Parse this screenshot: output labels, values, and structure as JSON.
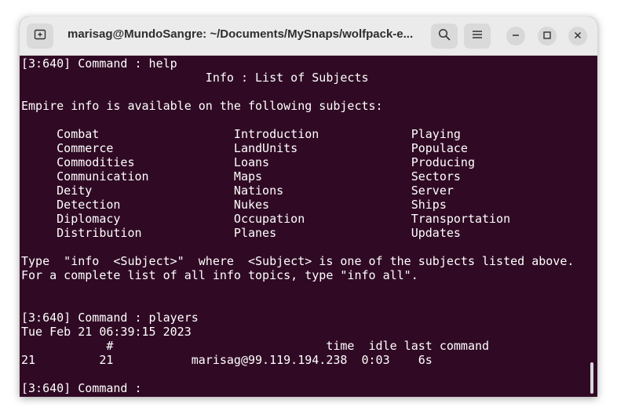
{
  "window": {
    "title": "marisag@MundoSangre: ~/Documents/MySnaps/wolfpack-e..."
  },
  "icons": {
    "new_tab": "new-tab-icon",
    "search": "search-icon",
    "menu": "hamburger-menu-icon",
    "minimize": "minimize-icon",
    "maximize": "maximize-icon",
    "close": "close-icon"
  },
  "colors": {
    "terminal_background": "#300a24",
    "terminal_text": "#ffffff",
    "titlebar": "#ebebeb"
  },
  "terminal": {
    "lines": [
      "[3:640] Command : help",
      "                          Info : List of Subjects",
      "",
      "Empire info is available on the following subjects:",
      "",
      "     Combat                   Introduction             Playing",
      "     Commerce                 LandUnits                Populace",
      "     Commodities              Loans                    Producing",
      "     Communication            Maps                     Sectors",
      "     Deity                    Nations                  Server",
      "     Detection                Nukes                    Ships",
      "     Diplomacy                Occupation               Transportation",
      "     Distribution             Planes                   Updates",
      "",
      "Type  \"info  <Subject>\"  where  <Subject> is one of the subjects listed above.",
      "For a complete list of all info topics, type \"info all\".",
      "",
      "",
      "[3:640] Command : players",
      "Tue Feb 21 06:39:15 2023",
      "            #                              time  idle last command",
      "21         21           marisag@99.119.194.238  0:03    6s",
      "",
      "[3:640] Command :"
    ]
  }
}
